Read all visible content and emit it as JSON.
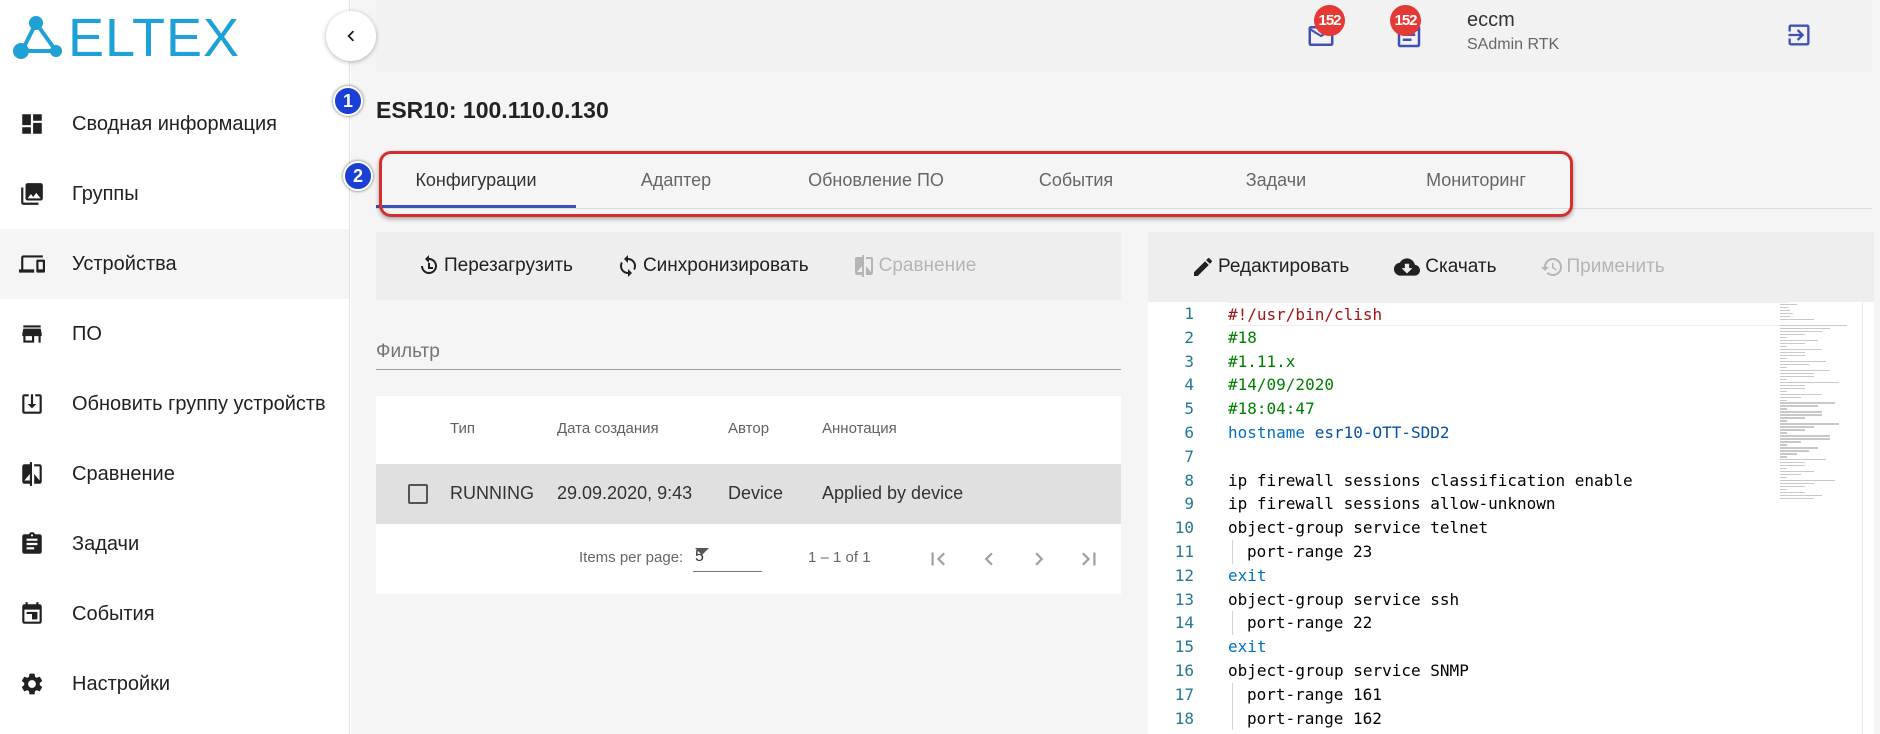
{
  "brand": {
    "name": "ELTEX",
    "color": "#1da1d6"
  },
  "sidebar": {
    "collapse_icon": "chevron-left-icon",
    "items": [
      {
        "label": "Сводная информация",
        "icon": "dashboard-icon",
        "active": false
      },
      {
        "label": "Группы",
        "icon": "image-stack-icon",
        "active": false
      },
      {
        "label": "Устройства",
        "icon": "devices-icon",
        "active": true
      },
      {
        "label": "ПО",
        "icon": "store-icon",
        "active": false
      },
      {
        "label": "Обновить группу устройств",
        "icon": "download-box-icon",
        "active": false
      },
      {
        "label": "Сравнение",
        "icon": "compare-icon",
        "active": false
      },
      {
        "label": "Задачи",
        "icon": "clipboard-icon",
        "active": false
      },
      {
        "label": "События",
        "icon": "calendar-icon",
        "active": false
      },
      {
        "label": "Настройки",
        "icon": "gear-icon",
        "active": false
      }
    ]
  },
  "header": {
    "mail_badge": "152",
    "tasks_badge": "152",
    "user_name": "eccm",
    "user_role": "SAdmin RTK",
    "badge_color": "#e53935"
  },
  "callouts": {
    "first": "1",
    "second": "2"
  },
  "page": {
    "title": "ESR10: 100.110.0.130",
    "tabs": [
      {
        "label": "Конфигурации",
        "active": true
      },
      {
        "label": "Адаптер",
        "active": false
      },
      {
        "label": "Обновление ПО",
        "active": false
      },
      {
        "label": "События",
        "active": false
      },
      {
        "label": "Задачи",
        "active": false
      },
      {
        "label": "Мониторинг",
        "active": false
      }
    ],
    "tab_indicator_color": "#3f51b5",
    "highlight_color": "#d32f2f"
  },
  "left_toolbar": {
    "reload": "Перезагрузить",
    "sync": "Синхронизировать",
    "compare": "Сравнение"
  },
  "filter": {
    "placeholder": "Фильтр"
  },
  "table": {
    "columns": [
      "Тип",
      "Дата создания",
      "Автор",
      "Аннотация"
    ],
    "rows": [
      {
        "type": "RUNNING",
        "created": "29.09.2020, 9:43",
        "author": "Device",
        "annotation": "Applied by device"
      }
    ],
    "paginator": {
      "items_per_page_label": "Items per page:",
      "items_per_page": "5",
      "range": "1 – 1 of 1"
    }
  },
  "right_toolbar": {
    "edit": "Редактировать",
    "download": "Скачать",
    "apply": "Применить"
  },
  "editor": {
    "lines": [
      {
        "n": "1",
        "indent": false,
        "tokens": [
          {
            "t": "#!/usr/bin/clish",
            "c": "red"
          }
        ]
      },
      {
        "n": "2",
        "indent": false,
        "tokens": [
          {
            "t": "#18",
            "c": "green"
          }
        ]
      },
      {
        "n": "3",
        "indent": false,
        "tokens": [
          {
            "t": "#1.11.x",
            "c": "green"
          }
        ]
      },
      {
        "n": "4",
        "indent": false,
        "tokens": [
          {
            "t": "#14/09/2020",
            "c": "green"
          }
        ]
      },
      {
        "n": "5",
        "indent": false,
        "tokens": [
          {
            "t": "#18:04:47",
            "c": "green"
          }
        ]
      },
      {
        "n": "6",
        "indent": false,
        "tokens": [
          {
            "t": "hostname",
            "c": "kw"
          },
          {
            "t": " esr10-OTT-SDD2",
            "c": "teal"
          }
        ]
      },
      {
        "n": "7",
        "indent": false,
        "tokens": []
      },
      {
        "n": "8",
        "indent": false,
        "tokens": [
          {
            "t": "ip firewall sessions classification enable",
            "c": "plain"
          }
        ]
      },
      {
        "n": "9",
        "indent": false,
        "tokens": [
          {
            "t": "ip firewall sessions allow-unknown",
            "c": "plain"
          }
        ]
      },
      {
        "n": "10",
        "indent": false,
        "tokens": [
          {
            "t": "object-group service telnet",
            "c": "plain"
          }
        ]
      },
      {
        "n": "11",
        "indent": true,
        "tokens": [
          {
            "t": "port-range 23",
            "c": "plain"
          }
        ]
      },
      {
        "n": "12",
        "indent": false,
        "tokens": [
          {
            "t": "exit",
            "c": "kw"
          }
        ]
      },
      {
        "n": "13",
        "indent": false,
        "tokens": [
          {
            "t": "object-group service ssh",
            "c": "plain"
          }
        ]
      },
      {
        "n": "14",
        "indent": true,
        "tokens": [
          {
            "t": "port-range 22",
            "c": "plain"
          }
        ]
      },
      {
        "n": "15",
        "indent": false,
        "tokens": [
          {
            "t": "exit",
            "c": "kw"
          }
        ]
      },
      {
        "n": "16",
        "indent": false,
        "tokens": [
          {
            "t": "object-group service SNMP",
            "c": "plain"
          }
        ]
      },
      {
        "n": "17",
        "indent": true,
        "tokens": [
          {
            "t": "port-range 161",
            "c": "plain"
          }
        ]
      },
      {
        "n": "18",
        "indent": true,
        "tokens": [
          {
            "t": "port-range 162",
            "c": "plain"
          }
        ]
      }
    ]
  }
}
